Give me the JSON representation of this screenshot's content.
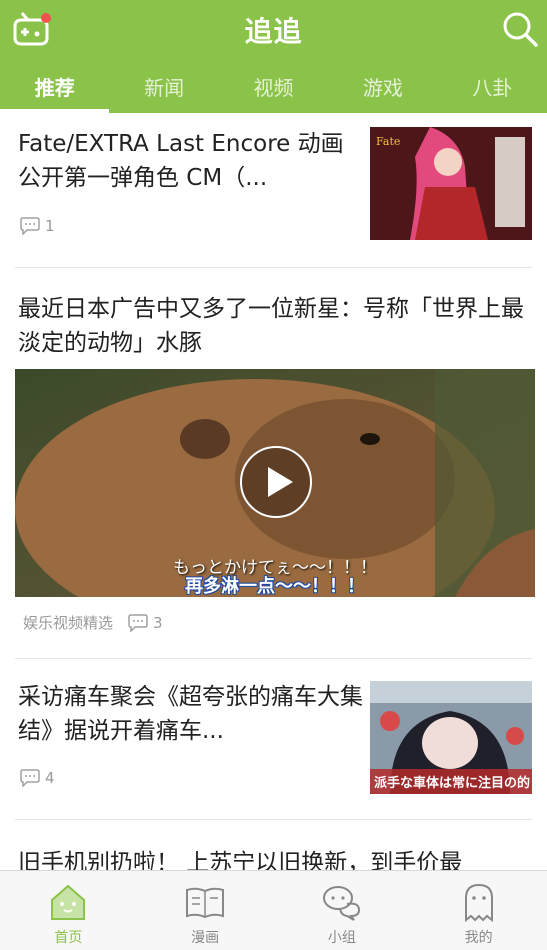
{
  "header": {
    "title": "追追",
    "left_icon": "game-controller-icon",
    "right_icon": "search-icon",
    "accent_color": "#8bc34a"
  },
  "tabs": [
    {
      "label": "推荐",
      "active": true
    },
    {
      "label": "新闻",
      "active": false
    },
    {
      "label": "视频",
      "active": false
    },
    {
      "label": "游戏",
      "active": false
    },
    {
      "label": "八卦",
      "active": false
    }
  ],
  "feed": [
    {
      "title": "Fate/EXTRA Last Encore 动画公开第一弹角色 CM（...",
      "comments": "1"
    },
    {
      "title": "最近日本广告中又多了一位新星：号称「世界上最淡定的动物」水豚",
      "source": "娱乐视频精选",
      "comments": "3",
      "subtitle_jp": "もっとかけてぇ〜〜！！！",
      "subtitle_cn": "再多淋一点～～！！！"
    },
    {
      "title": "采访痛车聚会《超夸张的痛车大集结》据说开着痛车...",
      "comments": "4",
      "thumb_text": "派手な車体は常に注目の的"
    },
    {
      "title": "旧手机别扔啦！ 上苏宁以旧换新，到手价最"
    }
  ],
  "bottom_nav": [
    {
      "label": "首页",
      "icon": "home-icon",
      "active": true
    },
    {
      "label": "漫画",
      "icon": "book-icon",
      "active": false
    },
    {
      "label": "小组",
      "icon": "chat-bubbles-icon",
      "active": false
    },
    {
      "label": "我的",
      "icon": "ghost-profile-icon",
      "active": false
    }
  ]
}
